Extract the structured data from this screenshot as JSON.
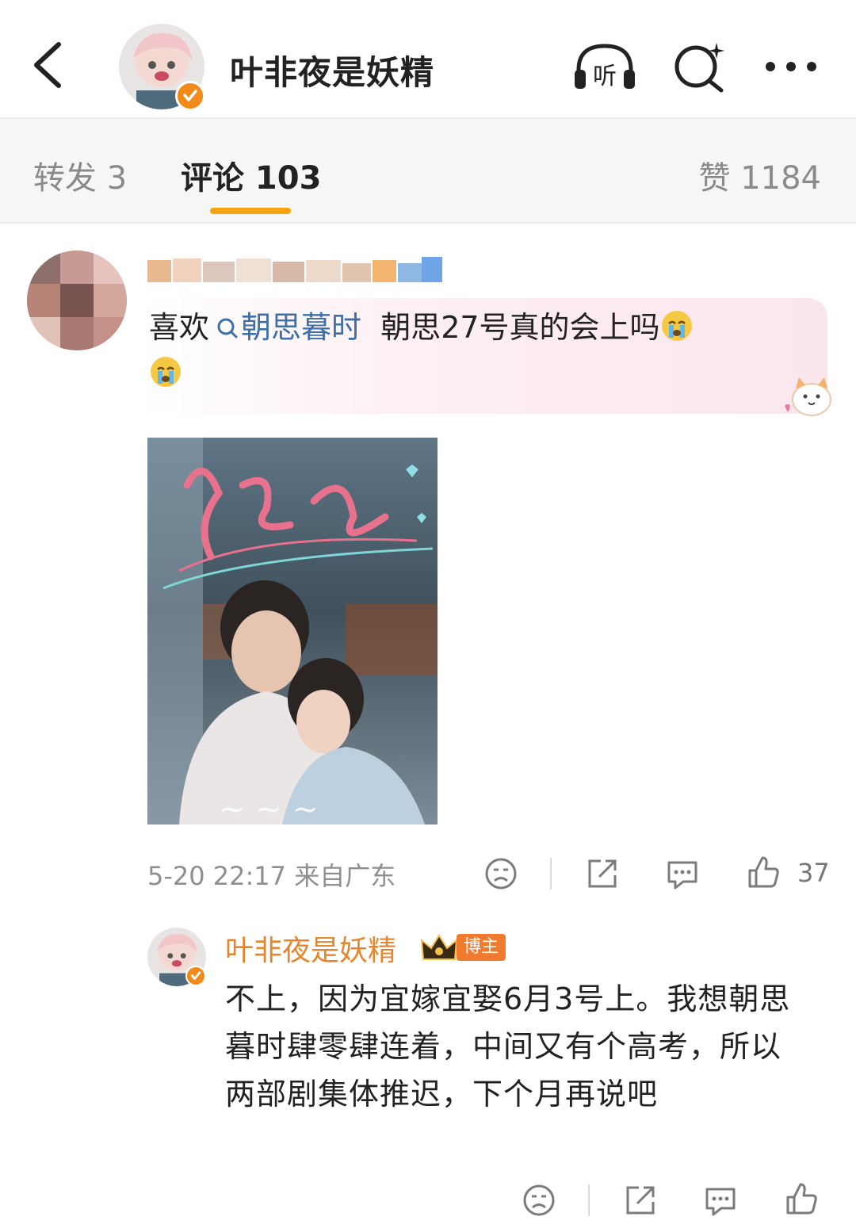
{
  "header": {
    "title": "叶非夜是妖精",
    "listen_label": "听"
  },
  "tabs": {
    "repost": "转发 3",
    "comments": "评论 103",
    "likes": "赞 1184"
  },
  "comment": {
    "text_prefix": "喜欢",
    "topic": "朝思暮时",
    "text_body": "朝思27号真的会上吗",
    "timestamp": "5-20 22:17 来自广东",
    "like_count": "37"
  },
  "reply": {
    "author": "叶非夜是妖精",
    "badge": "博主",
    "text": "不上，因为宜嫁宜娶6月3号上。我想朝思暮时肆零肆连着，中间又有个高考，所以两部剧集体推迟，下个月再说吧"
  },
  "colors": {
    "accent_orange": "#f6a410",
    "topic_blue": "#3f6fa8",
    "author_orange": "#e4862d"
  },
  "icons": [
    "back-arrow-icon",
    "listen-icon",
    "search-icon",
    "more-icon",
    "dislike-face-icon",
    "share-icon",
    "comment-icon",
    "thumbs-up-icon"
  ]
}
